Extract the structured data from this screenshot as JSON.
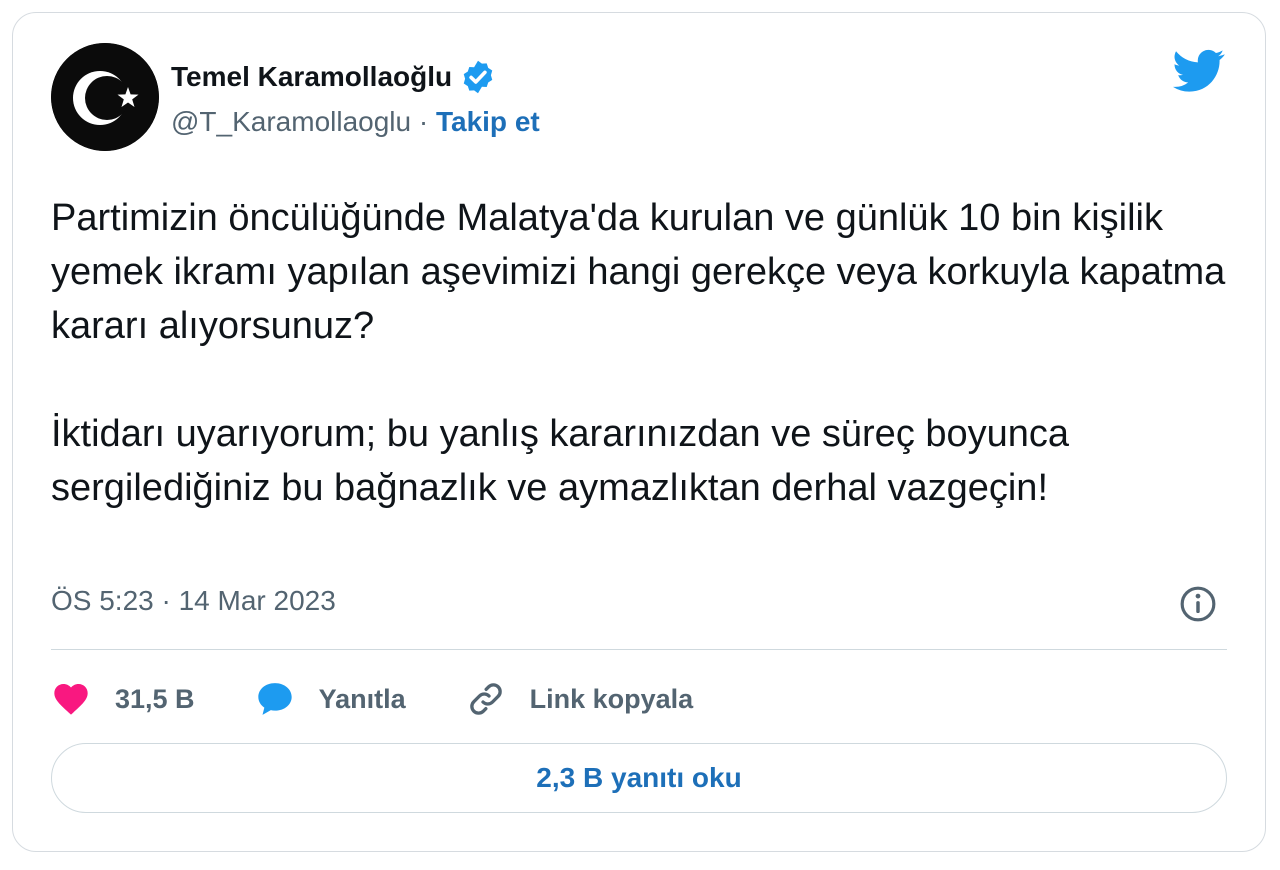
{
  "author": {
    "name": "Temel Karamollaoğlu",
    "handle": "@T_Karamollaoglu",
    "separator": "·",
    "follow_label": "Takip et",
    "avatar_icon": "crescent-star-icon",
    "verified_icon": "verified-badge-icon"
  },
  "brand": {
    "logo_icon": "twitter-bird-icon",
    "color": "#1d9bf0"
  },
  "tweet": {
    "paragraphs": [
      "Partimizin öncülüğünde Malatya'da kurulan ve günlük 10 bin kişilik yemek ikramı yapılan aşevimizi hangi gerekçe veya korkuyla kapatma kararı alıyorsunuz?",
      "İktidarı uyarıyorum; bu yanlış kararınızdan ve süreç boyunca sergilediğiniz bu bağnazlık ve aymazlıktan derhal vazgeçin!"
    ],
    "timestamp": "ÖS 5:23 · 14 Mar 2023",
    "info_icon": "info-icon"
  },
  "actions": {
    "like_count": "31,5 B",
    "like_icon": "heart-icon",
    "like_color": "#f91880",
    "reply_label": "Yanıtla",
    "reply_icon": "speech-bubble-icon",
    "reply_color": "#1d9bf0",
    "copy_link_label": "Link kopyala",
    "copy_link_icon": "link-icon"
  },
  "read_replies_label": "2,3 B yanıtı oku"
}
